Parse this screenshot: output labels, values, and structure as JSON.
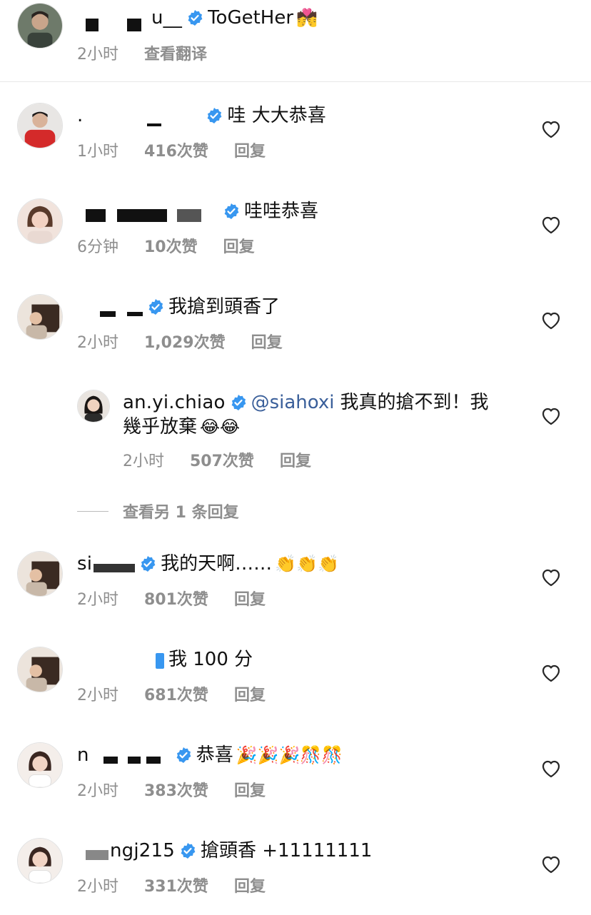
{
  "colors": {
    "meta_gray": "#8e8e8e",
    "verified_blue": "#3897f0",
    "mention_blue": "#3a5f9a"
  },
  "top_comment": {
    "username": "u__",
    "text": "ToGetHer",
    "emoji": "💏",
    "time": "2小时",
    "translate": "查看翻译"
  },
  "comments": [
    {
      "username": ".",
      "text": "哇 大大恭喜",
      "time": "1小时",
      "likes": "416次赞",
      "reply": "回复"
    },
    {
      "username": "",
      "text": "哇哇恭喜",
      "time": "6分钟",
      "likes": "10次赞",
      "reply": "回复"
    },
    {
      "username": "",
      "text": "我搶到頭香了",
      "time": "2小时",
      "likes": "1,029次赞",
      "reply": "回复"
    },
    {
      "username": "si",
      "text": "我的天啊……",
      "emoji": "👏👏👏",
      "time": "2小时",
      "likes": "801次赞",
      "reply": "回复"
    },
    {
      "username": "",
      "text": "我 100 分",
      "time": "2小时",
      "likes": "681次赞",
      "reply": "回复"
    },
    {
      "username": "n",
      "text": "恭喜",
      "emoji": "🎉🎉🎉🎊🎊",
      "time": "2小时",
      "likes": "383次赞",
      "reply": "回复"
    },
    {
      "username": "ngj215",
      "text": "搶頭香 +11111111",
      "time": "2小时",
      "likes": "331次赞",
      "reply": "回复"
    }
  ],
  "reply": {
    "username": "an.yi.chiao",
    "mention": "@siahoxi",
    "text_line1": "我真的搶不到！我",
    "text_line2": "幾乎放棄",
    "emoji": "😂😂",
    "time": "2小时",
    "likes": "507次赞",
    "reply": "回复"
  },
  "view_more_replies": "查看另 1 条回复",
  "icons": [
    "verified-badge-icon",
    "heart-icon"
  ]
}
